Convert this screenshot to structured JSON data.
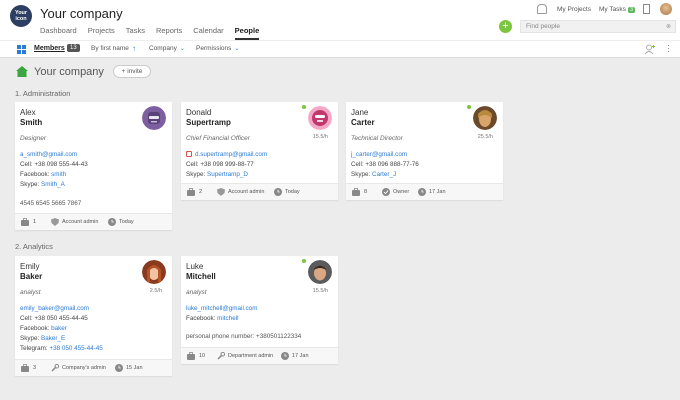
{
  "header": {
    "logo_text_1": "Your",
    "logo_text_2": "icon",
    "company_name": "Your company",
    "nav": [
      "Dashboard",
      "Projects",
      "Tasks",
      "Reports",
      "Calendar",
      "People"
    ],
    "active_nav": "People",
    "my_projects": "My Projects",
    "my_tasks": "My Tasks",
    "my_tasks_count": "3",
    "search_placeholder": "Find people"
  },
  "toolbar": {
    "members_label": "Members",
    "members_count": "13",
    "sort_label": "By first name",
    "company_filter": "Company",
    "permissions_filter": "Permissions"
  },
  "section": {
    "title": "Your company",
    "invite_label": "invite"
  },
  "groups": [
    {
      "title": "1. Administration",
      "cards": [
        {
          "first_name": "Alex",
          "last_name": "Smith",
          "role": "Designer",
          "email": "a_smith@gmail.com",
          "cell_label": "Cell:",
          "cell": "+38 098 555-44-43",
          "facebook_label": "Facebook:",
          "facebook": "smith",
          "skype_label": "Skype:",
          "skype": "Smith_A",
          "extra": "4545 6545 5665 7867",
          "projects": "1",
          "permission": "Account admin",
          "date": "Today"
        },
        {
          "first_name": "Donald",
          "last_name": "Supertramp",
          "role": "Chief Financial Officer",
          "time": "15.5/h",
          "email": "d.supertramp@gmail.com",
          "cell_label": "Cell:",
          "cell": "+38 098 999-88-77",
          "skype_label": "Skype:",
          "skype": "Supertramp_D",
          "projects": "2",
          "permission": "Account admin",
          "date": "Today"
        },
        {
          "first_name": "Jane",
          "last_name": "Carter",
          "role": "Technical Director",
          "time": "25.5/h",
          "email": "j_carter@gmail.com",
          "cell_label": "Cell:",
          "cell": "+38 096 888-77-76",
          "skype_label": "Skype:",
          "skype": "Carter_J",
          "projects": "8",
          "permission": "Owner",
          "date": "17 Jan"
        }
      ]
    },
    {
      "title": "2. Analytics",
      "cards": [
        {
          "first_name": "Emily",
          "last_name": "Baker",
          "role": "analyst",
          "time": "2.5/h",
          "email": "emily_baker@gmail.com",
          "cell_label": "Cell:",
          "cell": "+38 050 455-44-45",
          "facebook_label": "Facebook:",
          "facebook": "baker",
          "skype_label": "Skype:",
          "skype": "Baker_E",
          "telegram_label": "Telegram:",
          "telegram": "+38 050 455-44-45",
          "projects": "3",
          "permission": "Company's admin",
          "date": "15 Jan"
        },
        {
          "first_name": "Luke",
          "last_name": "Mitchell",
          "role": "analyst",
          "time": "15.5/h",
          "email": "luke_mitchell@gmail.com",
          "facebook_label": "Facebook:",
          "facebook": "mitchell",
          "extra": "personal phone number: +380501122334",
          "projects": "10",
          "permission": "Department admin",
          "date": "17 Jan"
        }
      ]
    }
  ],
  "colors": {
    "accent": "#2b7bd6",
    "green": "#7cc53f",
    "logo": "#2c3e61"
  }
}
